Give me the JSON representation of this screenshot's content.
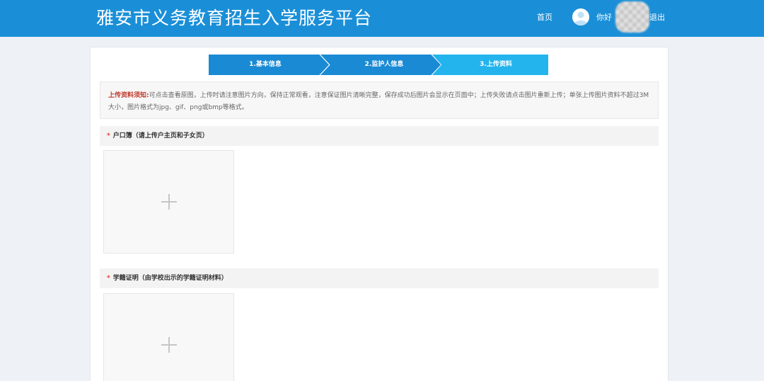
{
  "header": {
    "title": "雅安市义务教育招生入学服务平台",
    "home_label": "首页",
    "greeting": "你好",
    "logout_label": "退出"
  },
  "steps": [
    {
      "label": "1.基本信息",
      "state": "done"
    },
    {
      "label": "2.监护人信息",
      "state": "done"
    },
    {
      "label": "3.上传资料",
      "state": "active"
    }
  ],
  "notice": {
    "title": "上传资料须知:",
    "text": "可点击查看原图，上传时请注意图片方向，保持正常观看，注意保证图片清晰完整，保存成功后图片会显示在页面中；上传失败请点击图片重新上传；单张上传图片资料不超过3M大小，图片格式为jpg、gif、png或bmp等格式。"
  },
  "sections": [
    {
      "required_mark": "*",
      "title": "户口簿（请上传户主页和子女页）"
    },
    {
      "required_mark": "*",
      "title": "学籍证明（由学校出示的学籍证明材料）"
    }
  ],
  "colors": {
    "header_bg": "#1a8fd8",
    "step_done": "#1a8ad4",
    "step_active": "#23b4ee",
    "notice_title": "#c0392b",
    "required": "#e53935"
  },
  "icons": [
    "user-avatar-icon",
    "plus-icon"
  ]
}
